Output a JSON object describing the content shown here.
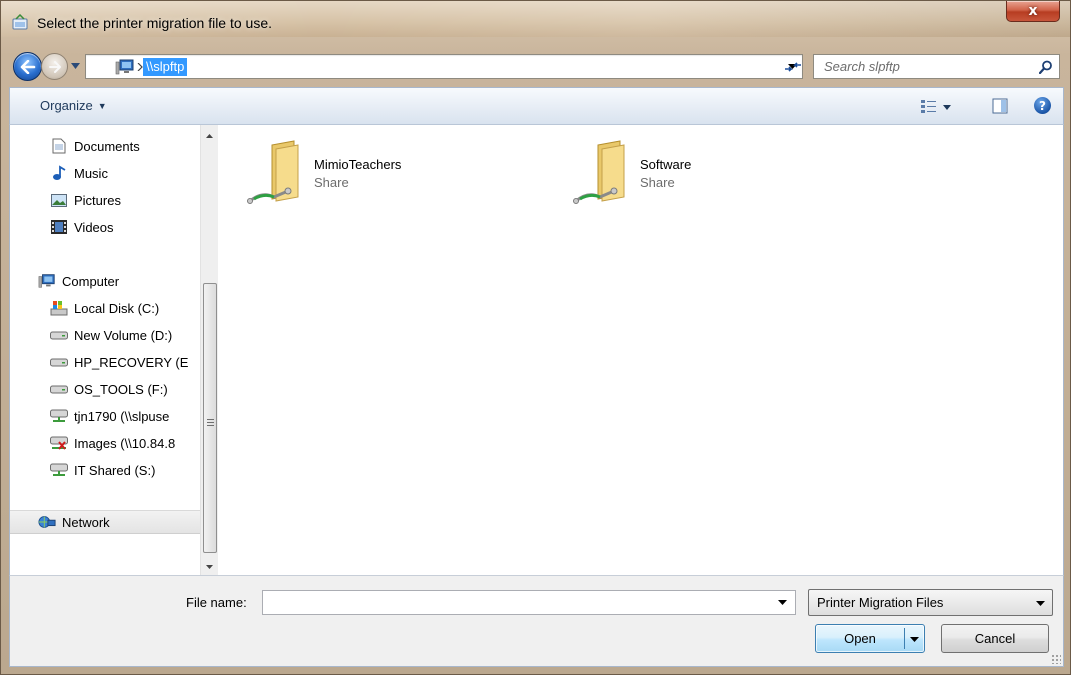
{
  "window": {
    "title": "Select the printer migration file to use.",
    "close_glyph": "x"
  },
  "address": {
    "path": "\\\\slpftp",
    "search_placeholder": "Search slpftp"
  },
  "toolbar": {
    "organize_label": "Organize",
    "help_glyph": "?"
  },
  "nav": {
    "items": [
      {
        "label": "Documents",
        "icon": "document-icon"
      },
      {
        "label": "Music",
        "icon": "music-icon"
      },
      {
        "label": "Pictures",
        "icon": "pictures-icon"
      },
      {
        "label": "Videos",
        "icon": "videos-icon"
      },
      {
        "label": "Computer",
        "icon": "computer-icon"
      },
      {
        "label": "Local Disk (C:)",
        "icon": "local-disk-icon"
      },
      {
        "label": "New Volume (D:)",
        "icon": "drive-icon"
      },
      {
        "label": "HP_RECOVERY (E",
        "icon": "drive-icon"
      },
      {
        "label": "OS_TOOLS (F:)",
        "icon": "drive-icon"
      },
      {
        "label": "tjn1790 (\\\\slpuse",
        "icon": "network-drive-icon"
      },
      {
        "label": "Images (\\\\10.84.8",
        "icon": "disconnected-drive-icon"
      },
      {
        "label": "IT Shared (S:)",
        "icon": "network-drive-icon"
      },
      {
        "label": "Network",
        "icon": "network-icon"
      }
    ]
  },
  "content": {
    "shares": [
      {
        "name": "MimioTeachers",
        "type": "Share"
      },
      {
        "name": "Software",
        "type": "Share"
      }
    ]
  },
  "bottom": {
    "file_name_label": "File name:",
    "file_name_value": "",
    "filter_value": "Printer Migration Files",
    "open_label": "Open",
    "cancel_label": "Cancel"
  },
  "colors": {
    "selection": "#3399ff",
    "toolbar_text": "#1e395b",
    "open_border": "#3c7fb1"
  }
}
